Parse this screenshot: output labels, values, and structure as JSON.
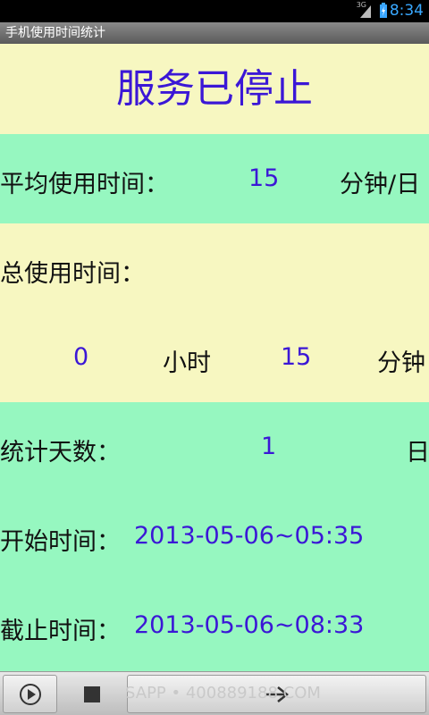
{
  "status_bar": {
    "network": "3G",
    "time": "8:34"
  },
  "title_bar": {
    "title": "手机使用时间统计"
  },
  "service_status": "服务已停止",
  "average": {
    "label": "平均使用时间：",
    "value": "15",
    "unit": "分钟/日"
  },
  "total": {
    "label": "总使用时间：",
    "hours": "0",
    "hours_unit": "小时",
    "minutes": "15",
    "minutes_unit": "分钟"
  },
  "stat_days": {
    "label": "统计天数：",
    "value": "1",
    "unit": "日"
  },
  "start_time": {
    "label": "开始时间：",
    "value": "2013-05-06~05:35"
  },
  "end_time": {
    "label": "截止时间：",
    "value": "2013-05-06~08:33"
  },
  "bottom_bar": {
    "watermark": "SAPP • 400889188.COM"
  },
  "colors": {
    "accent": "#3b17d6",
    "green_band": "#96f7c0",
    "yellow_band": "#f7f7c1"
  },
  "icons": [
    "play-icon",
    "stop-icon",
    "arrow-right-icon"
  ]
}
